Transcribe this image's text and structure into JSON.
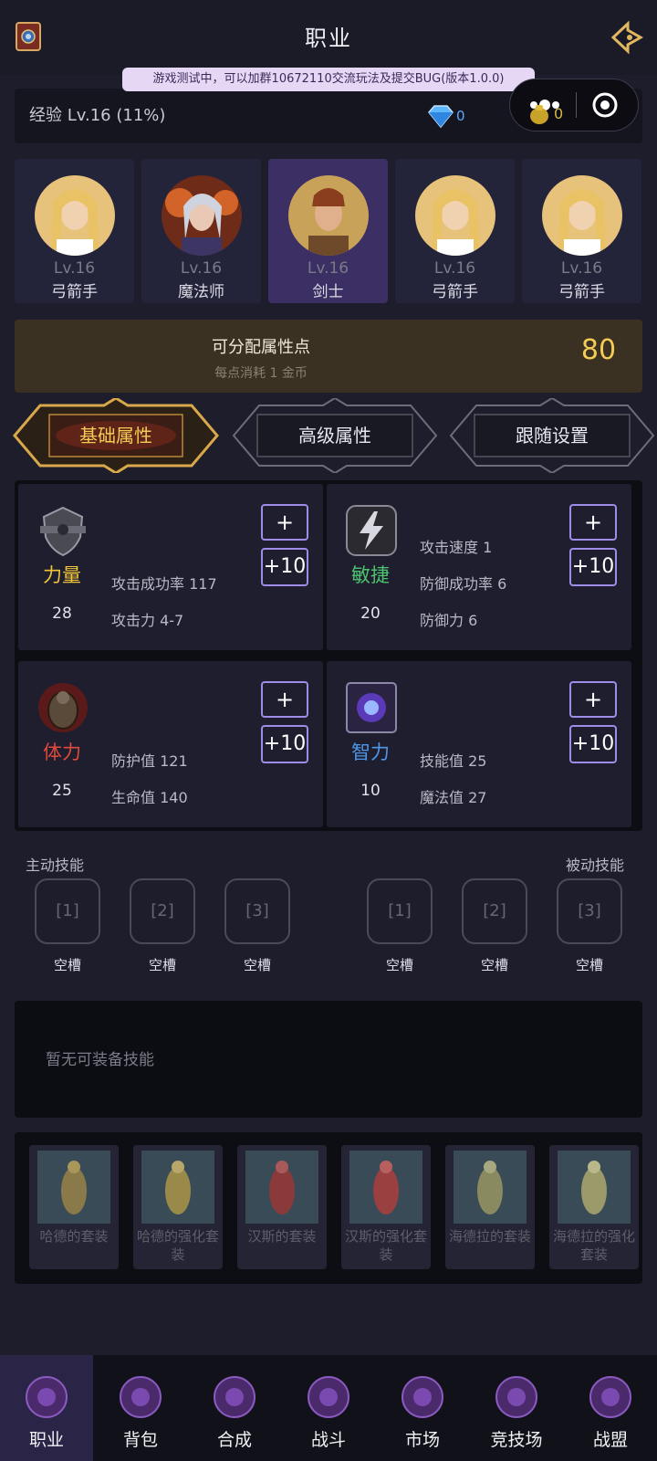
{
  "header": {
    "title": "职业"
  },
  "notice": "游戏测试中，可以加群10672110交流玩法及提交BUG(版本1.0.0)",
  "experience": {
    "label": "经验 Lv.16 (11%)",
    "diamonds": "0"
  },
  "capsule": {
    "gold": "0"
  },
  "characters": [
    {
      "level": "Lv.16",
      "name": "弓箭手"
    },
    {
      "level": "Lv.16",
      "name": "魔法师"
    },
    {
      "level": "Lv.16",
      "name": "剑士"
    },
    {
      "level": "Lv.16",
      "name": "弓箭手"
    },
    {
      "level": "Lv.16",
      "name": "弓箭手"
    }
  ],
  "points": {
    "title": "可分配属性点",
    "subtitle": "每点消耗 1 金币",
    "value": "80"
  },
  "tabs": [
    {
      "label": "基础属性"
    },
    {
      "label": "高级属性"
    },
    {
      "label": "跟随设置"
    }
  ],
  "stats": {
    "plus_label": "+",
    "plus_ten_label": "+10",
    "strength": {
      "name": "力量",
      "value": "28",
      "line1": "攻击成功率 117",
      "line2": "攻击力 4-7"
    },
    "agility": {
      "name": "敏捷",
      "value": "20",
      "line0": "攻击速度 1",
      "line1": "防御成功率 6",
      "line2": "防御力 6"
    },
    "vitality": {
      "name": "体力",
      "value": "25",
      "line1": "防护值 121",
      "line2": "生命值 140"
    },
    "intellect": {
      "name": "智力",
      "value": "10",
      "line1": "技能值 25",
      "line2": "魔法值 27"
    }
  },
  "skills": {
    "active_title": "主动技能",
    "passive_title": "被动技能",
    "slot_numbers": [
      "[1]",
      "[2]",
      "[3]"
    ],
    "empty_label": "空槽",
    "none_available": "暂无可装备技能"
  },
  "sets": [
    {
      "name": "哈德的套装"
    },
    {
      "name": "哈德的强化套装"
    },
    {
      "name": "汉斯的套装"
    },
    {
      "name": "汉斯的强化套装"
    },
    {
      "name": "海德拉的套装"
    },
    {
      "name": "海德拉的强化套装"
    }
  ],
  "bottom_nav": [
    {
      "label": "职业"
    },
    {
      "label": "背包"
    },
    {
      "label": "合成"
    },
    {
      "label": "战斗"
    },
    {
      "label": "市场"
    },
    {
      "label": "竞技场"
    },
    {
      "label": "战盟"
    }
  ],
  "colors": {
    "accent_gold": "#f3cb55",
    "strength": "#f0c43a",
    "agility": "#4cc36e",
    "vitality": "#e04a3c",
    "intellect": "#4f96e8",
    "selected_card": "#3b2f63"
  }
}
